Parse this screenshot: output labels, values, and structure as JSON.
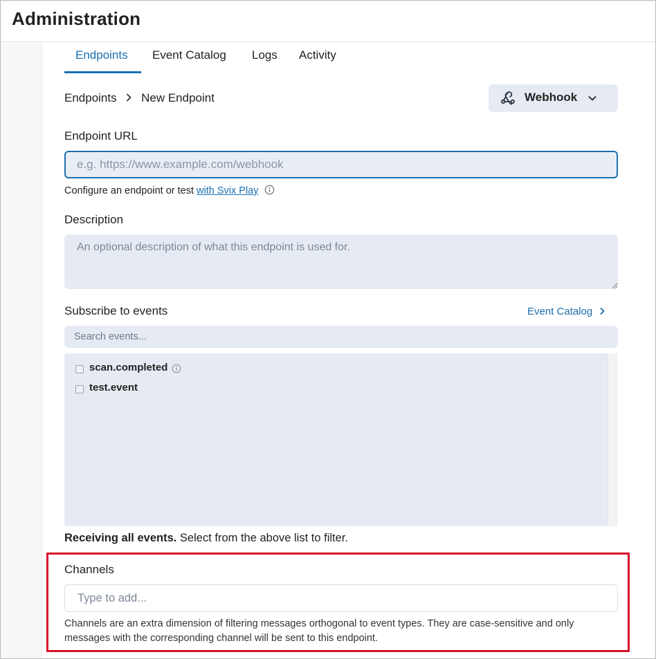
{
  "app": {
    "title": "Administration"
  },
  "tabs": [
    {
      "label": "Endpoints",
      "active": true
    },
    {
      "label": "Event Catalog",
      "active": false
    },
    {
      "label": "Logs",
      "active": false
    },
    {
      "label": "Activity",
      "active": false
    }
  ],
  "breadcrumb": {
    "parent": "Endpoints",
    "current": "New Endpoint"
  },
  "type_selector": {
    "label": "Webhook",
    "icon": "webhook-icon"
  },
  "endpoint_url": {
    "label": "Endpoint URL",
    "placeholder": "e.g. https://www.example.com/webhook",
    "value": "",
    "helper_prefix": "Configure an endpoint or test",
    "helper_link": "with Svix Play"
  },
  "description": {
    "label": "Description",
    "placeholder": "An optional description of what this endpoint is used for.",
    "value": ""
  },
  "subscribe": {
    "label": "Subscribe to events",
    "catalog_link": "Event Catalog",
    "search_placeholder": "Search events...",
    "events": [
      {
        "name": "scan.completed",
        "checked": false,
        "has_info": true
      },
      {
        "name": "test.event",
        "checked": false,
        "has_info": false
      }
    ],
    "receiving_bold": "Receiving all events.",
    "receiving_rest": "Select from the above list to filter."
  },
  "channels": {
    "label": "Channels",
    "placeholder": "Type to add...",
    "help": "Channels are an extra dimension of filtering messages orthogonal to event types. They are case-sensitive and only messages with the corresponding channel will be sent to this endpoint."
  },
  "colors": {
    "accent": "#1b6fb0",
    "field_bg": "#e6ebf3",
    "highlight": "#d8102b"
  }
}
